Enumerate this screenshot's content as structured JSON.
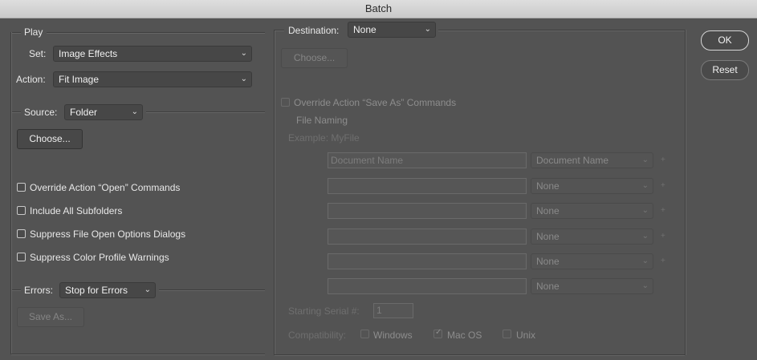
{
  "window": {
    "title": "Batch"
  },
  "play": {
    "group_label": "Play",
    "set_label": "Set:",
    "set_value": "Image Effects",
    "action_label": "Action:",
    "action_value": "Fit Image"
  },
  "source": {
    "label": "Source:",
    "value": "Folder",
    "choose_label": "Choose...",
    "options": [
      {
        "label": "Override Action “Open” Commands",
        "checked": false
      },
      {
        "label": "Include All Subfolders",
        "checked": false
      },
      {
        "label": "Suppress File Open Options Dialogs",
        "checked": false
      },
      {
        "label": "Suppress Color Profile Warnings",
        "checked": false
      }
    ]
  },
  "errors": {
    "label": "Errors:",
    "value": "Stop for Errors",
    "save_as_label": "Save As..."
  },
  "destination": {
    "label": "Destination:",
    "value": "None",
    "choose_label": "Choose...",
    "override_label": "Override Action “Save As” Commands",
    "file_naming_label": "File Naming",
    "example_label": "Example: MyFile",
    "naming_rows": [
      {
        "field": "Document Name",
        "select": "Document Name",
        "plus": "+"
      },
      {
        "field": "",
        "select": "None",
        "plus": "+"
      },
      {
        "field": "",
        "select": "None",
        "plus": "+"
      },
      {
        "field": "",
        "select": "None",
        "plus": "+"
      },
      {
        "field": "",
        "select": "None",
        "plus": "+"
      },
      {
        "field": "",
        "select": "None",
        "plus": ""
      }
    ],
    "serial_label": "Starting Serial #:",
    "serial_value": "1",
    "compat_label": "Compatibility:",
    "compat": [
      {
        "label": "Windows",
        "checked": false
      },
      {
        "label": "Mac OS",
        "checked": true
      },
      {
        "label": "Unix",
        "checked": false
      }
    ]
  },
  "buttons": {
    "ok": "OK",
    "reset": "Reset"
  }
}
